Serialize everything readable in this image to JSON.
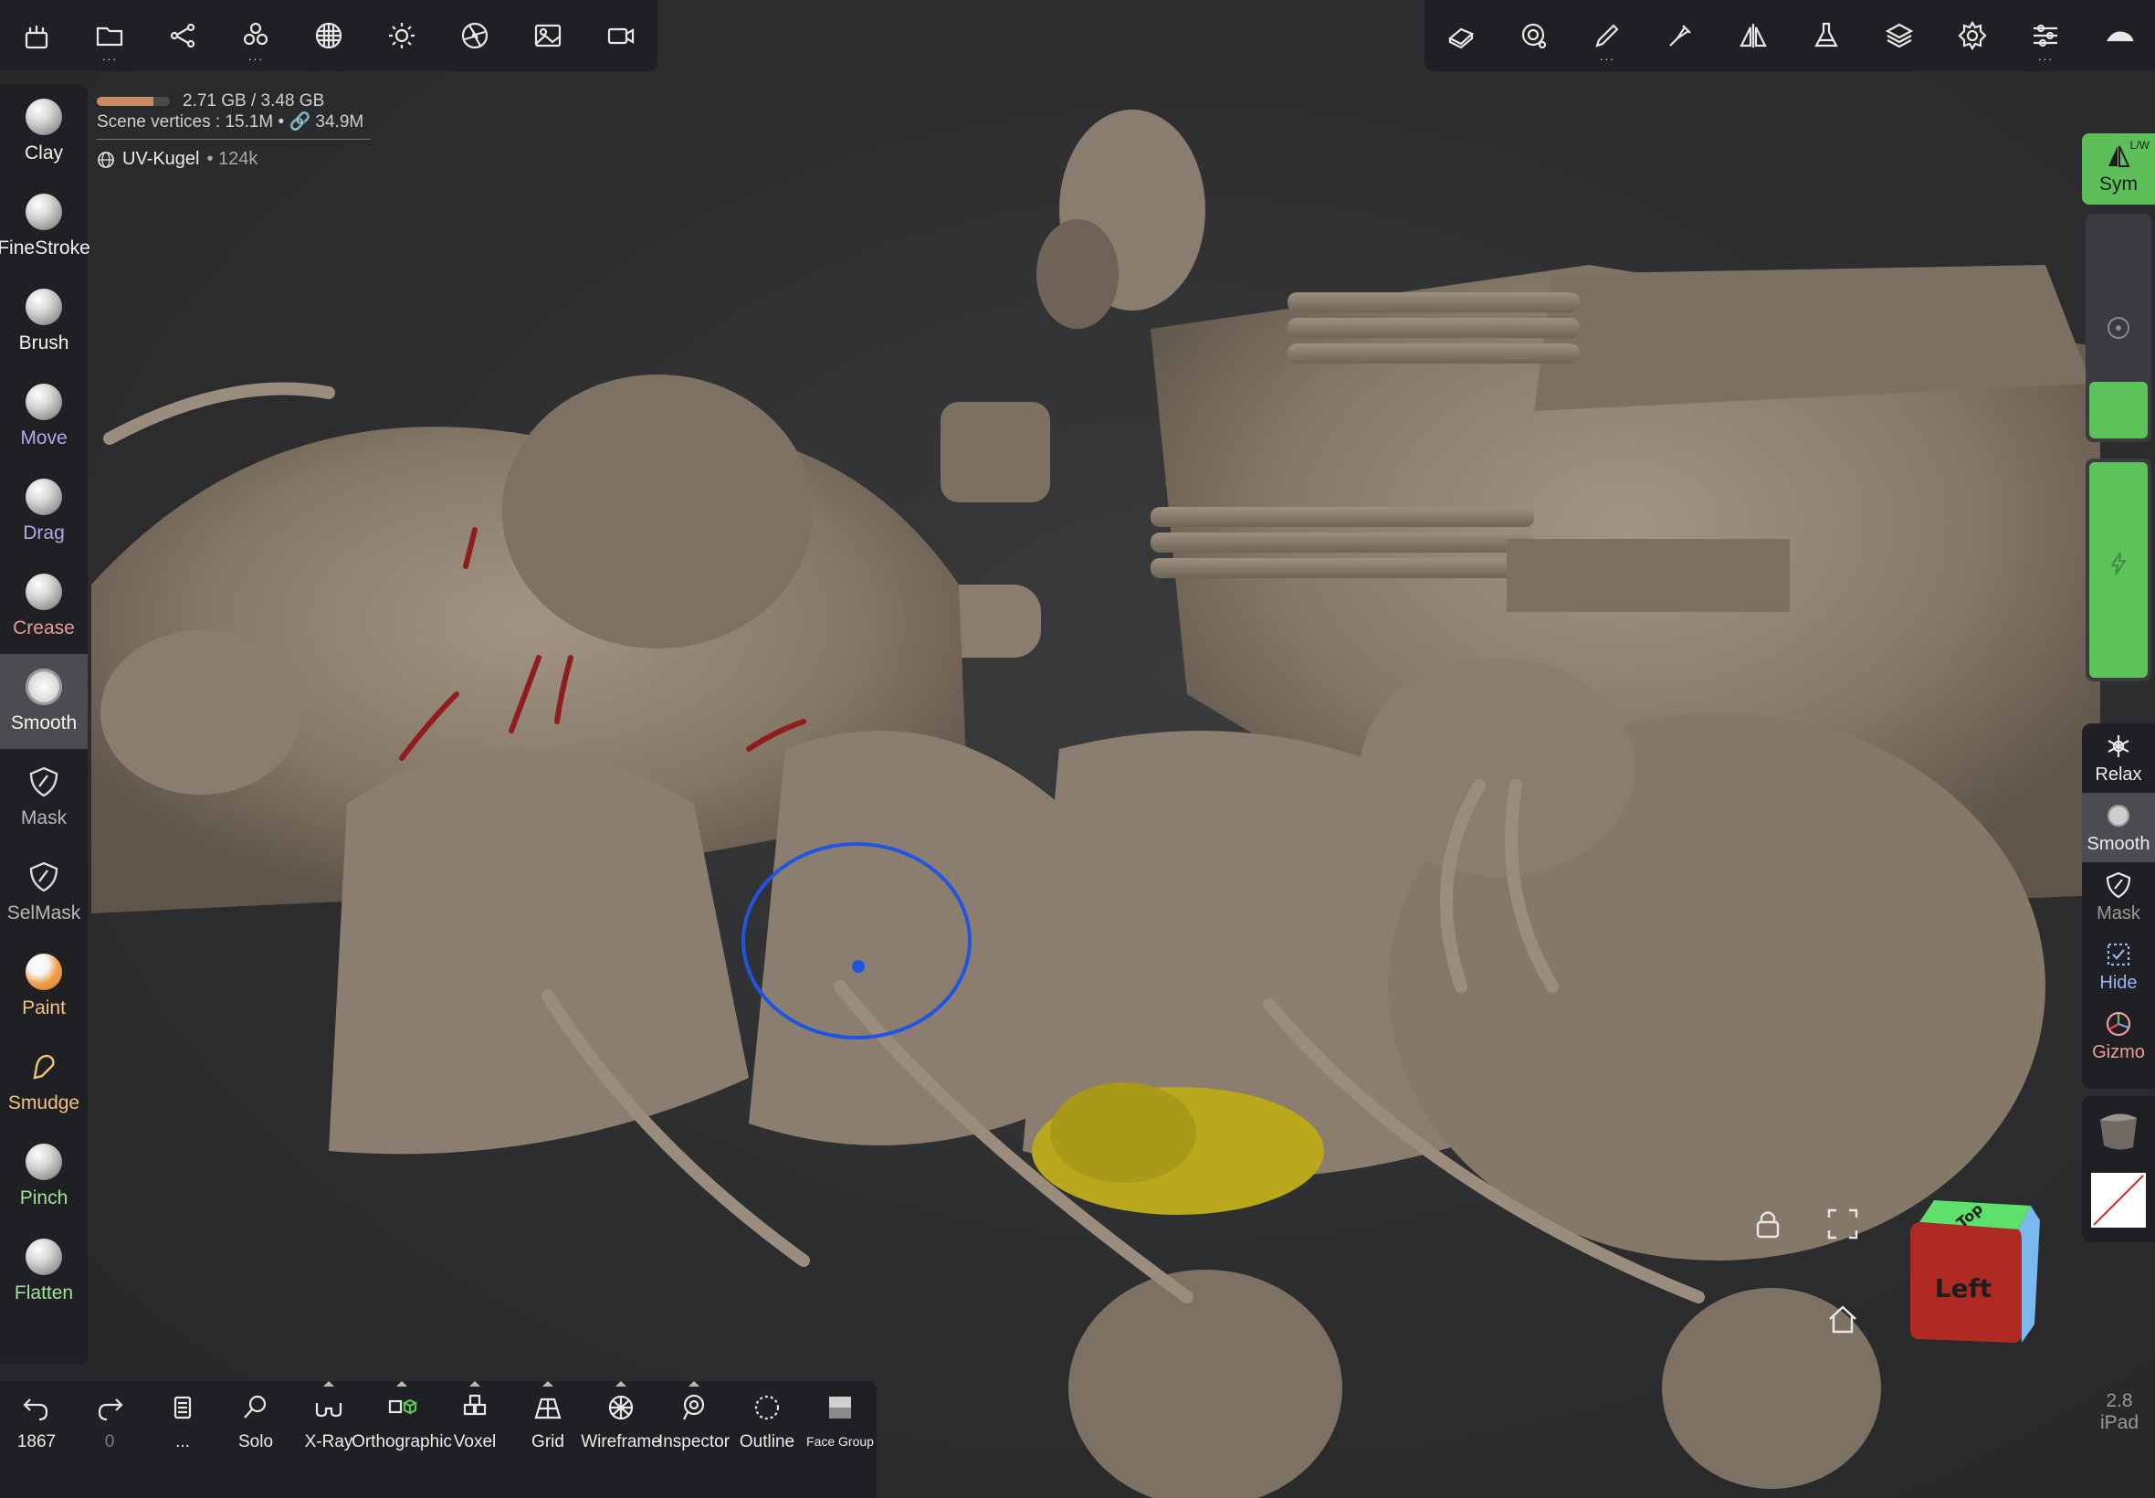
{
  "top_toolbar_left": [
    {
      "icon": "scene-icon",
      "dots": false
    },
    {
      "icon": "files-icon",
      "dots": true
    },
    {
      "icon": "scene-tree-icon",
      "dots": false
    },
    {
      "icon": "topology-icon",
      "dots": true
    },
    {
      "icon": "material-sphere-icon",
      "dots": false
    },
    {
      "icon": "lighting-icon",
      "dots": false
    },
    {
      "icon": "camera-aperture-icon",
      "dots": false
    },
    {
      "icon": "background-image-icon",
      "dots": false
    },
    {
      "icon": "video-camera-icon",
      "dots": false
    }
  ],
  "top_toolbar_right": [
    {
      "icon": "sculpt-tool-icon",
      "dots": false
    },
    {
      "icon": "brush-settings-icon",
      "dots": false
    },
    {
      "icon": "stroke-icon",
      "dots": true
    },
    {
      "icon": "paint-icon",
      "dots": false
    },
    {
      "icon": "symmetry-icon",
      "dots": false
    },
    {
      "icon": "flask-icon",
      "dots": false
    },
    {
      "icon": "layers-icon",
      "dots": false
    },
    {
      "icon": "settings-icon",
      "dots": false
    },
    {
      "icon": "sliders-icon",
      "dots": true
    },
    {
      "icon": "menu-more-icon",
      "dots": false
    }
  ],
  "info": {
    "memory": "2.71 GB / 3.48 GB",
    "memory_fraction": 0.78,
    "scene_vertices": "Scene vertices : 15.1M • 🔗 34.9M",
    "object_name": "UV-Kugel",
    "object_count": "• 124k"
  },
  "tools": [
    {
      "label": "Clay",
      "color": "#f2f2f2",
      "kind": "ball"
    },
    {
      "label": "FineStroke",
      "color": "#f2f2f2",
      "kind": "ball"
    },
    {
      "label": "Brush",
      "color": "#f2f2f2",
      "kind": "ball"
    },
    {
      "label": "Move",
      "color": "#b5a6e8",
      "kind": "ball"
    },
    {
      "label": "Drag",
      "color": "#b5a6e8",
      "kind": "ball"
    },
    {
      "label": "Crease",
      "color": "#f09a9a",
      "kind": "ball"
    },
    {
      "label": "Smooth",
      "color": "#f2f2f2",
      "kind": "spiky",
      "active": true
    },
    {
      "label": "Mask",
      "color": "#b8b8b8",
      "kind": "mask"
    },
    {
      "label": "SelMask",
      "color": "#b8b8b8",
      "kind": "mask"
    },
    {
      "label": "Paint",
      "color": "#f4c27a",
      "kind": "orange"
    },
    {
      "label": "Smudge",
      "color": "#f4c27a",
      "kind": "smudge"
    },
    {
      "label": "Pinch",
      "color": "#9fe49a",
      "kind": "ball"
    },
    {
      "label": "Flatten",
      "color": "#9fe49a",
      "kind": "ball"
    }
  ],
  "bottom_bar": [
    {
      "label": "1867",
      "icon": "undo-icon"
    },
    {
      "label": "0",
      "icon": "redo-icon",
      "dim": true
    },
    {
      "label": "...",
      "icon": "history-icon"
    },
    {
      "label": "Solo",
      "icon": "magnifier-icon"
    },
    {
      "label": "X-Ray",
      "icon": "xray-glasses-icon",
      "tick": true
    },
    {
      "label": "Orthographic",
      "icon": "orthographic-icon",
      "tick": true
    },
    {
      "label": "Voxel",
      "icon": "voxel-icon",
      "tick": true
    },
    {
      "label": "Grid",
      "icon": "grid-icon",
      "tick": true
    },
    {
      "label": "Wireframe",
      "icon": "wireframe-icon",
      "tick": true
    },
    {
      "label": "Inspector",
      "icon": "inspector-icon",
      "tick": true
    },
    {
      "label": "Outline",
      "icon": "outline-icon"
    },
    {
      "label": "Face Group",
      "icon": "face-group-icon",
      "small": true
    }
  ],
  "right_bar": {
    "sym_label": "Sym",
    "sym_sup": "L/W",
    "radius_fraction": 0.28,
    "intensity_fraction": 1.0,
    "items": [
      {
        "label": "Relax",
        "icon": "relax-icon",
        "color": "#ececec"
      },
      {
        "label": "Smooth",
        "icon": "smooth-icon",
        "color": "#ececec",
        "active": true
      },
      {
        "label": "Mask",
        "icon": "mask-icon",
        "color": "#9a9a9a"
      },
      {
        "label": "Hide",
        "icon": "hide-icon",
        "color": "#9bb4f5"
      },
      {
        "label": "Gizmo",
        "icon": "gizmo-icon",
        "color": "#f09a9a"
      }
    ]
  },
  "view_cube": {
    "front": "Left",
    "top": "Top"
  },
  "version": {
    "number": "2.8",
    "device": "iPad"
  },
  "colors": {
    "accent": "#5cc25a",
    "brush_circle": "#1f55e0",
    "model": "#8a7d70",
    "highlight": "#b9a81c"
  }
}
